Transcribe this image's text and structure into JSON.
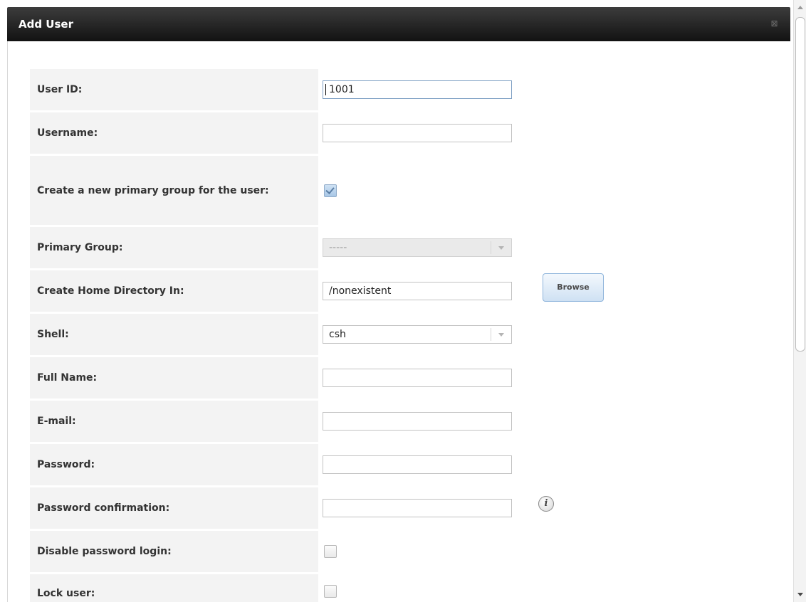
{
  "dialog": {
    "title": "Add User",
    "close_glyph": "⊠"
  },
  "form": {
    "user_id": {
      "label": "User ID:",
      "value": "1001"
    },
    "username": {
      "label": "Username:",
      "value": ""
    },
    "create_primary_group": {
      "label": "Create a new primary group for the user:",
      "checked": true
    },
    "primary_group": {
      "label": "Primary Group:",
      "value": "-----",
      "disabled": true
    },
    "home_directory": {
      "label": "Create Home Directory In:",
      "value": "/nonexistent",
      "browse_label": "Browse"
    },
    "shell": {
      "label": "Shell:",
      "value": "csh"
    },
    "full_name": {
      "label": "Full Name:",
      "value": ""
    },
    "email": {
      "label": "E-mail:",
      "value": ""
    },
    "password": {
      "label": "Password:",
      "value": ""
    },
    "password_confirmation": {
      "label": "Password confirmation:",
      "value": "",
      "info_glyph": "i"
    },
    "disable_password_login": {
      "label": "Disable password login:",
      "checked": false
    },
    "lock_user": {
      "label": "Lock user:",
      "checked": false
    }
  },
  "icons": {
    "close": "close-icon",
    "info": "info-icon",
    "dropdown": "chevron-down-icon",
    "checkmark": "check-icon"
  }
}
